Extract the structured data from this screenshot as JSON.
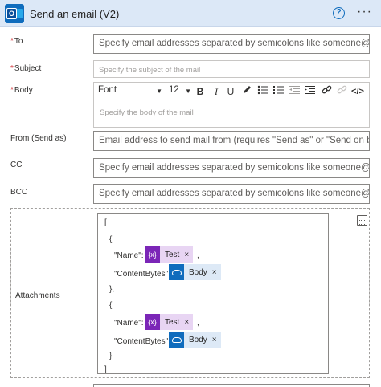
{
  "header": {
    "title": "Send an email (V2)",
    "help": "?",
    "more": "···"
  },
  "fields": {
    "to": {
      "label": "To",
      "required": "*",
      "placeholder": "Specify email addresses separated by semicolons like someone@cont"
    },
    "subject": {
      "label": "Subject",
      "required": "*",
      "placeholder": "Specify the subject of the mail"
    },
    "body": {
      "label": "Body",
      "required": "*",
      "placeholder": "Specify the body of the mail"
    },
    "from": {
      "label": "From (Send as)",
      "placeholder": "Email address to send mail from (requires \"Send as\" or \"Send on beha"
    },
    "cc": {
      "label": "CC",
      "placeholder": "Specify email addresses separated by semicolons like someone@cont"
    },
    "bcc": {
      "label": "BCC",
      "placeholder": "Specify email addresses separated by semicolons like someone@cont"
    }
  },
  "toolbar": {
    "font": "Font",
    "size": "12",
    "bold": "B",
    "italic": "I",
    "underline": "U",
    "source": "</>"
  },
  "attachments": {
    "label": "Attachments",
    "open_bracket": "[",
    "close_bracket": "]",
    "open_brace": "{",
    "close_brace_comma": "},",
    "close_brace": "}",
    "name_key": "\"Name\":",
    "content_key": "\"ContentBytes\":",
    "comma": ",",
    "items": [
      {
        "name_token": "Test",
        "content_token": "Body"
      },
      {
        "name_token": "Test",
        "content_token": "Body"
      }
    ],
    "var_icon": "{x}",
    "remove": "×"
  }
}
